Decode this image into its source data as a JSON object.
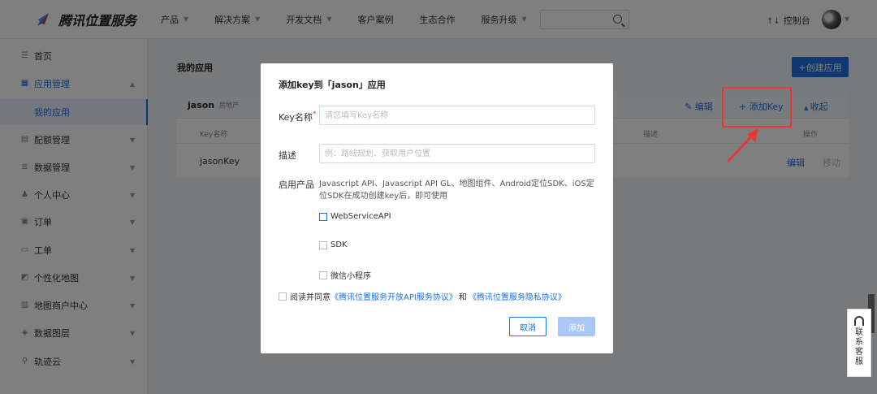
{
  "header": {
    "brand": "腾讯位置服务",
    "nav": [
      {
        "label": "产品",
        "caret": true
      },
      {
        "label": "解决方案",
        "caret": true
      },
      {
        "label": "开发文档",
        "caret": true
      },
      {
        "label": "客户案例",
        "caret": false
      },
      {
        "label": "生态合作",
        "caret": false
      },
      {
        "label": "服务升级",
        "caret": true
      }
    ],
    "search_placeholder": "",
    "console": "控制台"
  },
  "sidebar": {
    "items": [
      {
        "label": "首页",
        "icon": "☰",
        "caret": false
      },
      {
        "label": "应用管理",
        "icon": "▦",
        "caret": true,
        "expanded": true
      },
      {
        "label": "配额管理",
        "icon": "▤",
        "caret": true
      },
      {
        "label": "数据管理",
        "icon": "≣",
        "caret": true
      },
      {
        "label": "个人中心",
        "icon": "♟",
        "caret": true
      },
      {
        "label": "订单",
        "icon": "▣",
        "caret": true
      },
      {
        "label": "工单",
        "icon": "▭",
        "caret": true
      },
      {
        "label": "个性化地图",
        "icon": "◩",
        "caret": true
      },
      {
        "label": "地图商户中心",
        "icon": "▥",
        "caret": true
      },
      {
        "label": "数据图层",
        "icon": "◈",
        "caret": true
      },
      {
        "label": "轨迹云",
        "icon": "⚲",
        "caret": true
      }
    ],
    "sub_active": "我的应用"
  },
  "main": {
    "title": "我的应用",
    "create_button": "+创建应用",
    "app": {
      "name": "jason",
      "tag": "房地产",
      "edit": "编辑",
      "add_key": "+ 添加Key",
      "collapse": "收起",
      "columns": [
        "Key名称",
        "描述",
        "操作"
      ],
      "rows": [
        {
          "key_name": "jasonKey",
          "op_edit": "编辑",
          "op_move": "移动"
        }
      ]
    }
  },
  "modal": {
    "title": "添加key到「jason」应用",
    "key_name_label": "Key名称",
    "key_name_placeholder": "请您填写Key名称",
    "desc_label": "描述",
    "desc_placeholder": "例：路线规划、获取用户位置",
    "product_label": "启用产品",
    "product_desc": "Javascript API、Javascript API GL、地图组件、Android定位SDK、iOS定位SDK在成功创建key后，即可使用",
    "options": [
      {
        "label": "WebServiceAPI",
        "checked": false
      },
      {
        "label": "SDK",
        "checked": false
      },
      {
        "label": "微信小程序",
        "checked": false
      }
    ],
    "agree_prefix": "阅读并同意",
    "agree_link1": "《腾讯位置服务开放API服务协议》",
    "agree_and": "和",
    "agree_link2": "《腾讯位置服务隐私协议》",
    "cancel": "取消",
    "add": "添加"
  },
  "service_widget": {
    "label": "联系客服"
  },
  "colors": {
    "primary": "#1f6fe5",
    "highlight": "#e53935"
  }
}
